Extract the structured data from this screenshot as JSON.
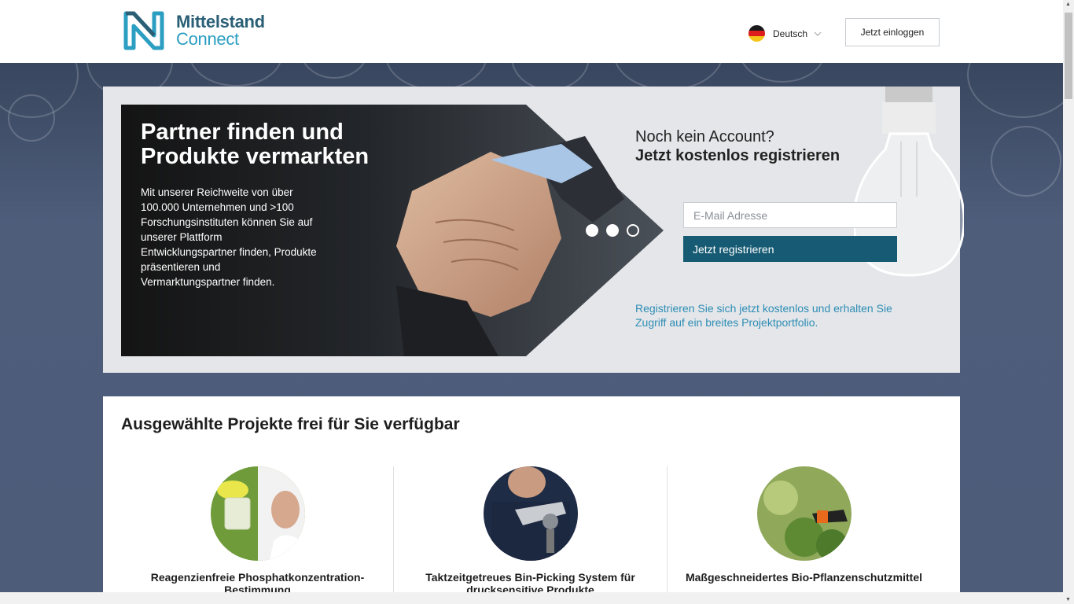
{
  "header": {
    "logo_line1": "Mittelstand",
    "logo_line2": "Connect",
    "language": "Deutsch",
    "login_label": "Jetzt einloggen"
  },
  "hero": {
    "title": "Partner finden und Produkte vermarkten",
    "text": "Mit unserer Reichweite von über 100.000 Unternehmen und >100 Forschungsinstituten können Sie auf unserer Plattform Entwicklungspartner finden, Produkte präsentieren und Vermarktungspartner finden.",
    "slides": 3,
    "active_slide": 3
  },
  "register": {
    "question": "Noch kein Account?",
    "headline": "Jetzt kostenlos registrieren",
    "email_placeholder": "E-Mail Adresse",
    "button_label": "Jetzt registrieren",
    "note": "Registrieren Sie sich jetzt kostenlos und erhalten Sie Zugriff auf ein breites Projektportfolio."
  },
  "projects": {
    "heading": "Ausgewählte Projekte frei für Sie verfügbar",
    "items": [
      {
        "title": "Reagenzienfreie Phosphatkonzentration-Bestimmung"
      },
      {
        "title": "Taktzeitgetreues Bin-Picking System für drucksensitive Produkte"
      },
      {
        "title": "Maßgeschneidertes Bio-Pflanzenschutzmittel"
      }
    ]
  },
  "colors": {
    "brand_dark": "#2a5f76",
    "brand_light": "#2b9ec2",
    "button": "#165b73",
    "link": "#2e8db5"
  }
}
